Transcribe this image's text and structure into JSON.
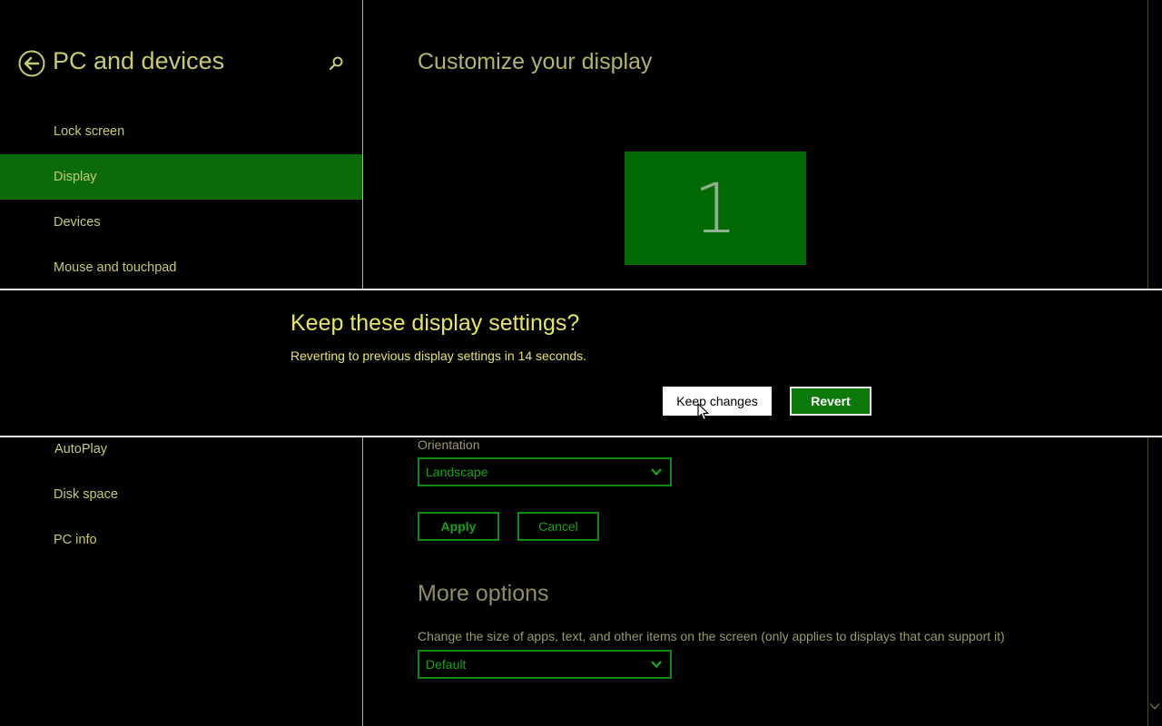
{
  "sidebar": {
    "title": "PC and devices",
    "items_top": [
      {
        "label": "Lock screen"
      },
      {
        "label": "Display"
      },
      {
        "label": "Devices"
      },
      {
        "label": "Mouse and touchpad"
      }
    ],
    "items_bottom": [
      {
        "label": "AutoPlay"
      },
      {
        "label": "Disk space"
      },
      {
        "label": "PC info"
      }
    ],
    "selected": "Display"
  },
  "main": {
    "title": "Customize your display",
    "monitor_number": "1",
    "orientation": {
      "label": "Orientation",
      "value": "Landscape"
    },
    "apply_label": "Apply",
    "cancel_label": "Cancel",
    "more_options_title": "More options",
    "scale": {
      "label": "Change the size of apps, text, and other items on the screen (only applies to displays that can support it)",
      "value": "Default"
    }
  },
  "dialog": {
    "title": "Keep these display settings?",
    "message": "Reverting to previous display settings in 14 seconds.",
    "keep_label": "Keep changes",
    "revert_label": "Revert"
  },
  "icons": {
    "back": "back-arrow-icon",
    "search": "search-icon",
    "chevron": "chevron-down-icon",
    "cursor": "mouse-pointer-icon"
  },
  "colors": {
    "accent": "#0b6b0b",
    "text_accent": "#c9c970",
    "dialog_text": "#e6e664",
    "control_green": "#0e8a0e"
  }
}
